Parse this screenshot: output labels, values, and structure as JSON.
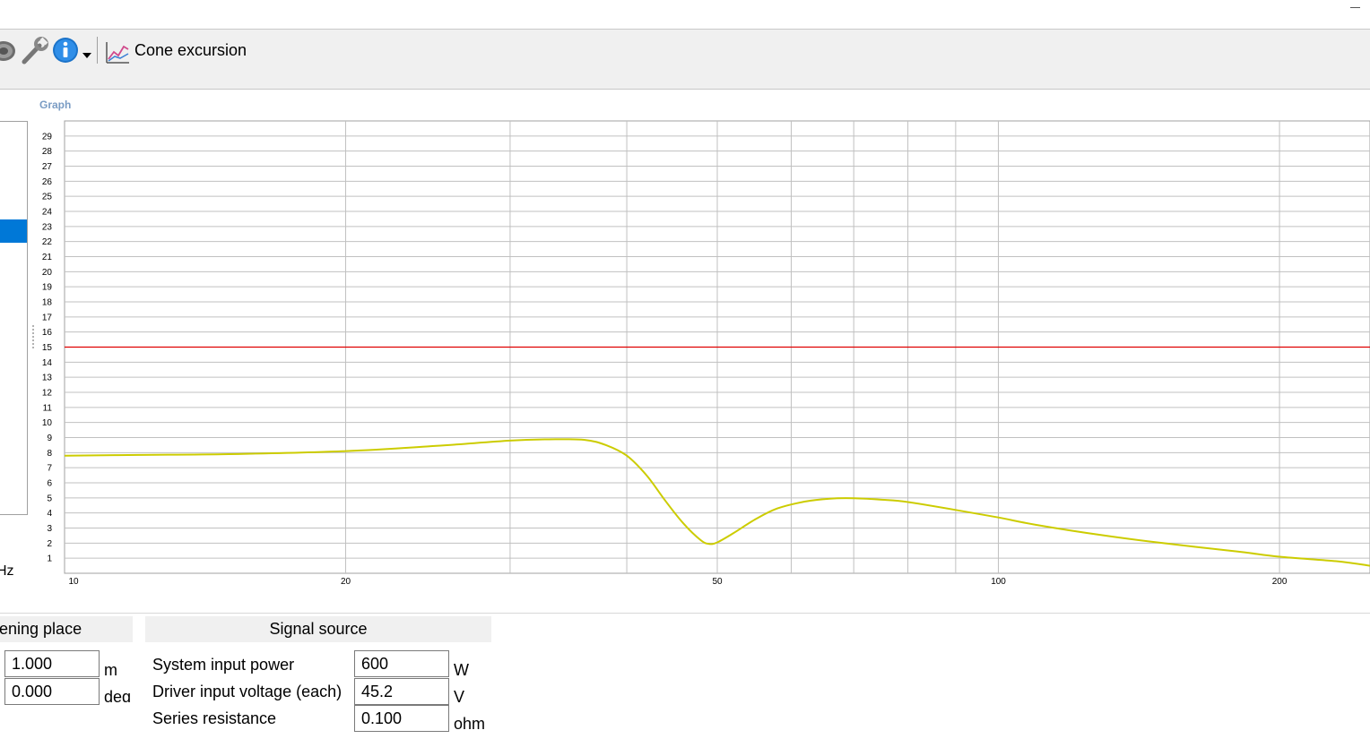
{
  "toolbar": {
    "driver_icon": "speaker-driver-icon",
    "tools_icon": "wrench-icon",
    "info_icon": "info-icon",
    "dropdown_icon": "chevron-down-icon",
    "chart_icon": "line-chart-icon",
    "view_label": "Cone excursion"
  },
  "graph_panel": {
    "label": "Graph"
  },
  "left_panel": {
    "unit_fragment": "Hz"
  },
  "chart_data": {
    "type": "line",
    "title": "",
    "xlabel": "",
    "ylabel": "",
    "x_scale": "log",
    "xlim": [
      10,
      250
    ],
    "ylim": [
      0,
      30
    ],
    "x_ticks": [
      10,
      20,
      50,
      100,
      200
    ],
    "y_ticks": [
      1,
      2,
      3,
      4,
      5,
      6,
      7,
      8,
      9,
      10,
      11,
      12,
      13,
      14,
      15,
      16,
      17,
      18,
      19,
      20,
      21,
      22,
      23,
      24,
      25,
      26,
      27,
      28,
      29
    ],
    "grid": true,
    "limit_line": {
      "value": 15,
      "color": "#e00000"
    },
    "series": [
      {
        "color": "#cccc00",
        "x": [
          10,
          12,
          15,
          20,
          25,
          30,
          33,
          36,
          38,
          40,
          42,
          44,
          46,
          48,
          49,
          50,
          52,
          55,
          58,
          62,
          66,
          70,
          75,
          80,
          90,
          100,
          110,
          130,
          150,
          180,
          200,
          230,
          250
        ],
        "y": [
          7.8,
          7.85,
          7.9,
          8.1,
          8.45,
          8.8,
          8.88,
          8.85,
          8.5,
          7.8,
          6.5,
          4.8,
          3.3,
          2.2,
          1.95,
          2.05,
          2.65,
          3.6,
          4.3,
          4.75,
          4.95,
          4.98,
          4.88,
          4.72,
          4.2,
          3.7,
          3.2,
          2.5,
          2.0,
          1.45,
          1.1,
          0.8,
          0.5
        ]
      }
    ]
  },
  "listening_place": {
    "header": "tening place",
    "distance": {
      "value": "1.000",
      "unit": "m"
    },
    "angle": {
      "value": "0.000",
      "unit": "deg"
    }
  },
  "signal_source": {
    "header": "Signal source",
    "system_input_power": {
      "label": "System input power",
      "value": "600",
      "unit": "W"
    },
    "driver_input_voltage": {
      "label": "Driver input voltage (each)",
      "value": "45.2",
      "unit": "V"
    },
    "series_resistance": {
      "label": "Series resistance",
      "value": "0.100",
      "unit": "ohm"
    }
  }
}
